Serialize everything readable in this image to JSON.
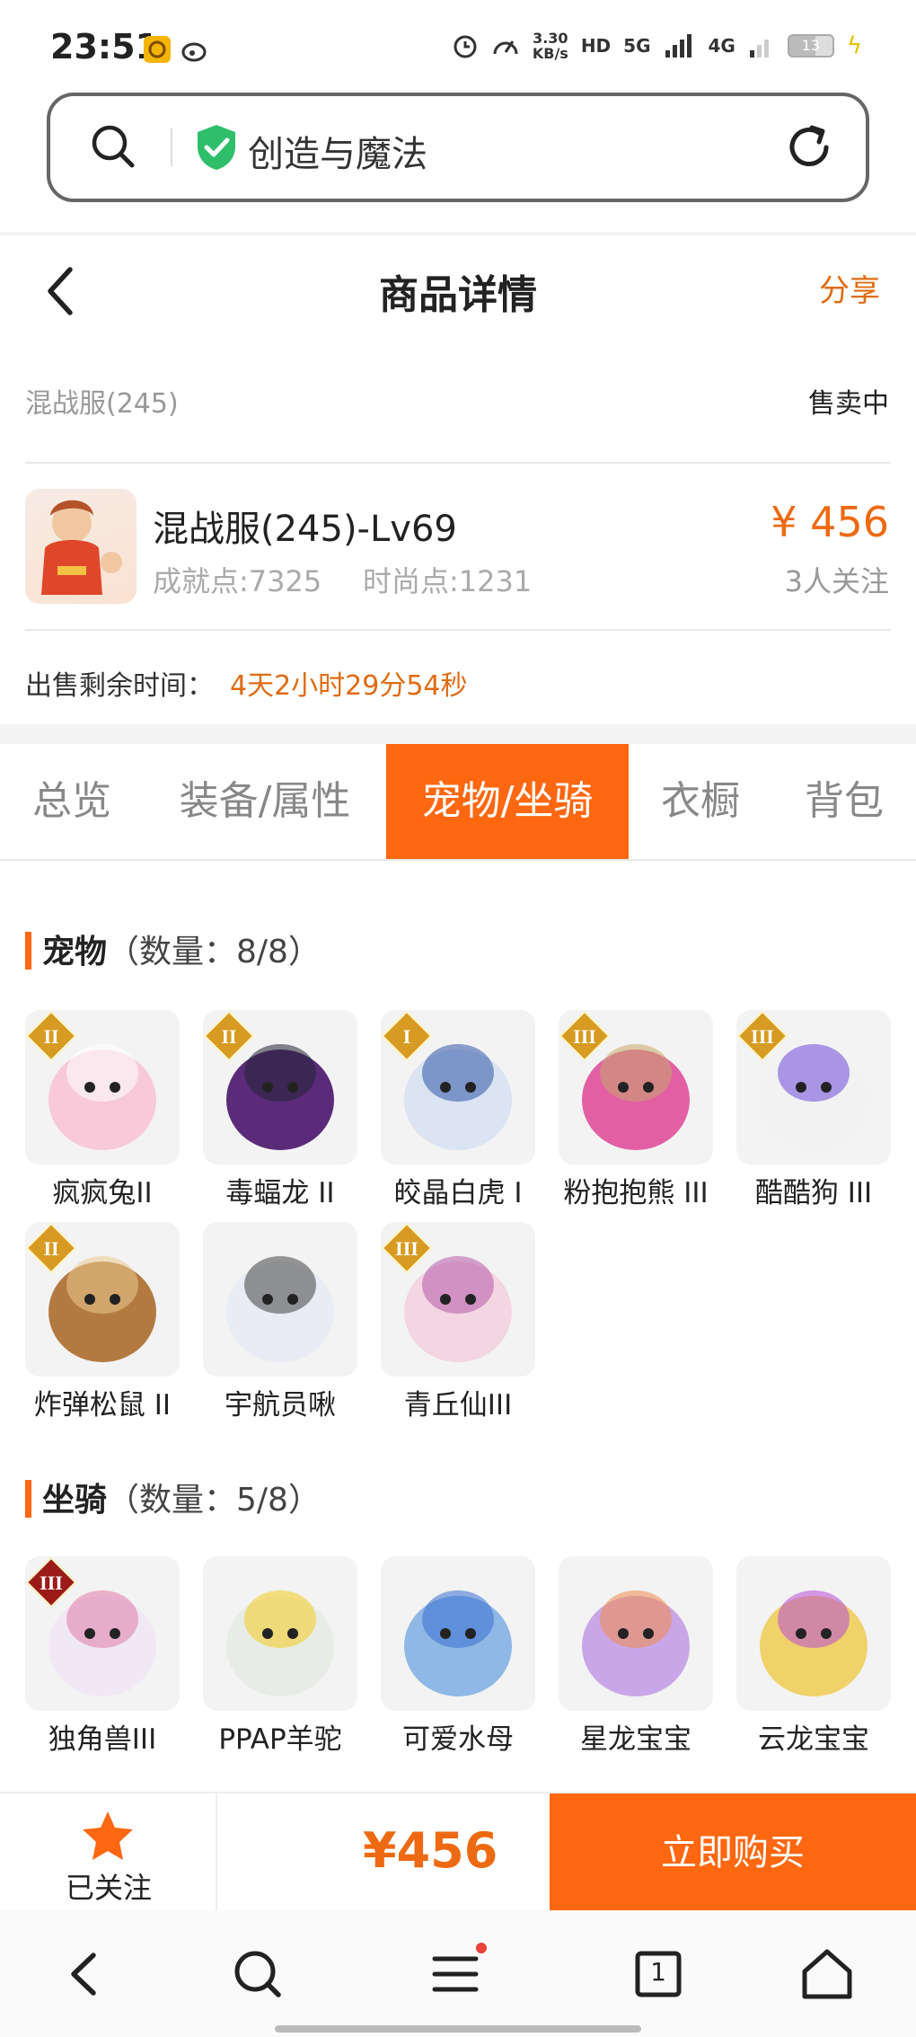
{
  "status_bar": {
    "time": "23:51",
    "net_speed_value": "3.30",
    "net_speed_unit": "KB/s",
    "hd_tag": "HD",
    "net_5g": "5G",
    "net_4g": "4G",
    "battery": "13",
    "icons": [
      "app-notification-icon",
      "weibo-icon",
      "alarm-icon",
      "speedometer-icon",
      "hd-icon",
      "signal-icon",
      "battery-icon",
      "charging-icon"
    ]
  },
  "address_bar": {
    "title": "创造与魔法",
    "icons": [
      "search-icon",
      "verified-shield-icon",
      "reload-icon"
    ]
  },
  "header": {
    "title": "商品详情",
    "share_label": "分享",
    "icons": [
      "back-icon"
    ]
  },
  "listing": {
    "server": "混战服(245)",
    "status": "售卖中",
    "name": "混战服(245)-Lv69",
    "achievement": "成就点:7325",
    "fashion": "时尚点:1231",
    "price": "¥ 456",
    "watchers": "3人关注",
    "remaining_label": "出售剩余时间：",
    "remaining_value": "4天2小时29分54秒"
  },
  "tabs": [
    {
      "label": "总览",
      "active": false
    },
    {
      "label": "装备/属性",
      "active": false
    },
    {
      "label": "宠物/坐骑",
      "active": true
    },
    {
      "label": "衣橱",
      "active": false
    },
    {
      "label": "背包",
      "active": false
    }
  ],
  "pets": {
    "title": "宠物",
    "count": "（数量：8/8）",
    "items": [
      {
        "name": "疯疯兔II",
        "color": "#f7c9d9",
        "accent": "#ffffff",
        "badge": "II"
      },
      {
        "name": "毒蝠龙 II",
        "color": "#5b2b7a",
        "accent": "#222233",
        "badge": "II"
      },
      {
        "name": "皎晶白虎 I",
        "color": "#dbe4f2",
        "accent": "#2f55a8",
        "badge": "I"
      },
      {
        "name": "粉抱抱熊 III",
        "color": "#e35fa4",
        "accent": "#c7a86a",
        "badge": "III"
      },
      {
        "name": "酷酷狗 III",
        "color": "#f2f2f2",
        "accent": "#6b4bd8",
        "badge": "III"
      },
      {
        "name": "炸弹松鼠 II",
        "color": "#b37a3f",
        "accent": "#e9c98f",
        "badge": "II"
      },
      {
        "name": "宇航员啾",
        "color": "#e9ecf3",
        "accent": "#444444",
        "badge": ""
      },
      {
        "name": "青丘仙III",
        "color": "#f3d6e2",
        "accent": "#b55aa8",
        "badge": "III"
      }
    ]
  },
  "mounts": {
    "title": "坐骑",
    "count": "（数量：5/8）",
    "items": [
      {
        "name": "独角兽III",
        "color": "#f0e8f2",
        "accent": "#e07aa8",
        "badge": "III"
      },
      {
        "name": "PPAP羊驼",
        "color": "#e8ece6",
        "accent": "#f2cc1d",
        "badge": ""
      },
      {
        "name": "可爱水母",
        "color": "#8fb8e6",
        "accent": "#3a6fd0",
        "badge": ""
      },
      {
        "name": "星龙宝宝",
        "color": "#c9a6e8",
        "accent": "#f08a4b",
        "badge": ""
      },
      {
        "name": "云龙宝宝",
        "color": "#f0d26a",
        "accent": "#b84bd6",
        "badge": ""
      }
    ]
  },
  "action_bar": {
    "follow_label": "已关注",
    "price": "¥456",
    "buy_label": "立即购买"
  },
  "browser_nav": {
    "tabs_count": "1",
    "icons": [
      "back-icon",
      "search-icon",
      "menu-icon",
      "tabs-icon",
      "home-icon"
    ]
  },
  "colors": {
    "accent": "#ff6710",
    "price": "#ee6a12"
  }
}
